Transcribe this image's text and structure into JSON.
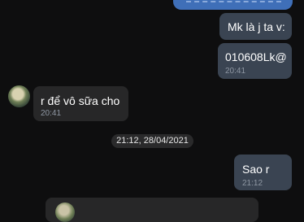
{
  "messages": [
    {
      "text": "Mk là j ta v:",
      "time": ""
    },
    {
      "text": "010608Lk@",
      "time": "20:41"
    },
    {
      "text": "r để vô sữa cho",
      "time": "20:41"
    },
    {
      "text": "Sao r",
      "time": "21:12"
    }
  ],
  "date_separator": "21:12, 28/04/2021",
  "colors": {
    "background": "#0e0e0f",
    "outgoing_bubble": "#3a4452",
    "incoming_bubble": "#272728",
    "accent": "#3f6fb8",
    "timestamp": "#8f97a3"
  }
}
